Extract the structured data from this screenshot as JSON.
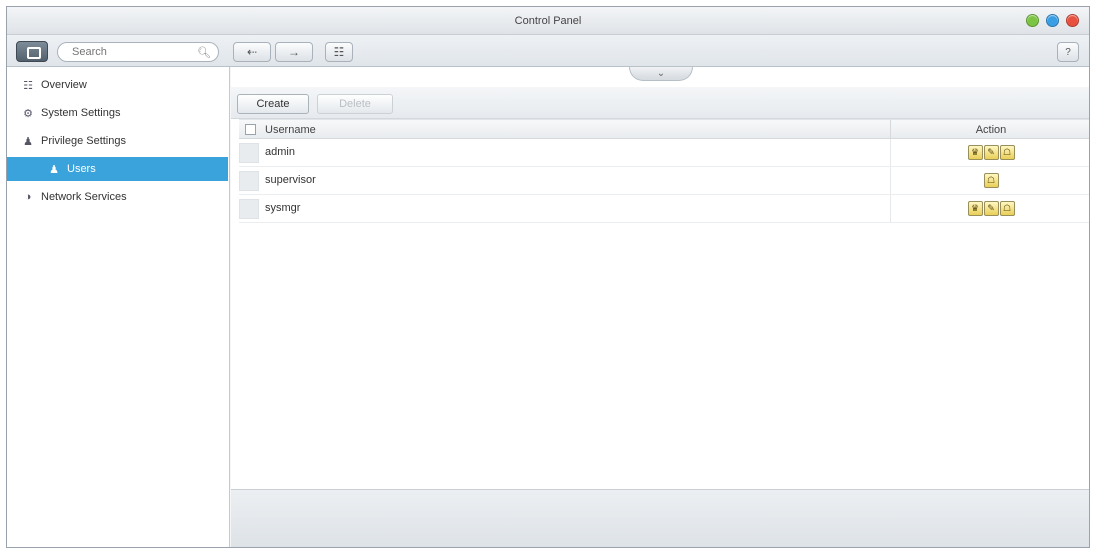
{
  "window": {
    "title": "Control Panel",
    "controls": [
      {
        "name": "minimize-icon",
        "color": "#7cc443"
      },
      {
        "name": "maximize-icon",
        "color": "#3a9ee4"
      },
      {
        "name": "close-icon",
        "color": "#e8513f"
      }
    ]
  },
  "toolbar": {
    "search_placeholder": "Search",
    "back_icon": "⇠",
    "forward_icon": "→",
    "grid_icon": "☷",
    "help_label": "?"
  },
  "sidebar": {
    "items": [
      {
        "label": "Overview",
        "icon": "☷"
      },
      {
        "label": "System Settings",
        "icon": "⚙"
      },
      {
        "label": "Privilege Settings",
        "icon": "♟"
      },
      {
        "label": "Users",
        "icon": "♟"
      },
      {
        "label": "Network Services",
        "icon": "◑"
      }
    ],
    "active_color": "#3aa3dc"
  },
  "main": {
    "collapse_icon": "⌄",
    "create_label": "Create",
    "delete_label": "Delete",
    "columns": {
      "username": "Username",
      "action": "Action"
    },
    "rows": [
      {
        "username": "admin",
        "actions": [
          "♛",
          "✎",
          "☖"
        ]
      },
      {
        "username": "supervisor",
        "actions": [
          "☖"
        ]
      },
      {
        "username": "sysmgr",
        "actions": [
          "♛",
          "✎",
          "☖"
        ]
      }
    ]
  }
}
